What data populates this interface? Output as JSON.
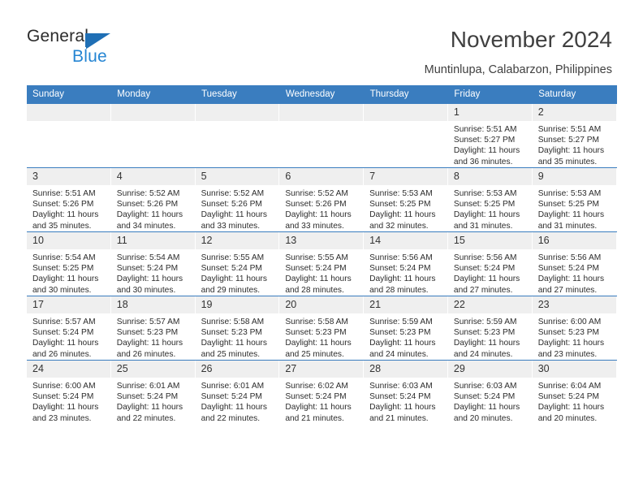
{
  "brand": {
    "name_part1": "General",
    "name_part2": "Blue",
    "triangle_color": "#1f6fb5",
    "blue_text_color": "#2585d3"
  },
  "header": {
    "title": "November 2024",
    "subtitle": "Muntinlupa, Calabarzon, Philippines",
    "accent_color": "#3a7dbf",
    "daynum_background": "#efefef"
  },
  "weekdays": [
    "Sunday",
    "Monday",
    "Tuesday",
    "Wednesday",
    "Thursday",
    "Friday",
    "Saturday"
  ],
  "labels": {
    "sunrise_prefix": "Sunrise:",
    "sunset_prefix": "Sunset:",
    "daylight_prefix": "Daylight:"
  },
  "weeks": [
    [
      {
        "day": "",
        "empty": true
      },
      {
        "day": "",
        "empty": true
      },
      {
        "day": "",
        "empty": true
      },
      {
        "day": "",
        "empty": true
      },
      {
        "day": "",
        "empty": true
      },
      {
        "day": "1",
        "sunrise": "Sunrise: 5:51 AM",
        "sunset": "Sunset: 5:27 PM",
        "daylight_line1": "Daylight: 11 hours",
        "daylight_line2": "and 36 minutes."
      },
      {
        "day": "2",
        "sunrise": "Sunrise: 5:51 AM",
        "sunset": "Sunset: 5:27 PM",
        "daylight_line1": "Daylight: 11 hours",
        "daylight_line2": "and 35 minutes."
      }
    ],
    [
      {
        "day": "3",
        "sunrise": "Sunrise: 5:51 AM",
        "sunset": "Sunset: 5:26 PM",
        "daylight_line1": "Daylight: 11 hours",
        "daylight_line2": "and 35 minutes."
      },
      {
        "day": "4",
        "sunrise": "Sunrise: 5:52 AM",
        "sunset": "Sunset: 5:26 PM",
        "daylight_line1": "Daylight: 11 hours",
        "daylight_line2": "and 34 minutes."
      },
      {
        "day": "5",
        "sunrise": "Sunrise: 5:52 AM",
        "sunset": "Sunset: 5:26 PM",
        "daylight_line1": "Daylight: 11 hours",
        "daylight_line2": "and 33 minutes."
      },
      {
        "day": "6",
        "sunrise": "Sunrise: 5:52 AM",
        "sunset": "Sunset: 5:26 PM",
        "daylight_line1": "Daylight: 11 hours",
        "daylight_line2": "and 33 minutes."
      },
      {
        "day": "7",
        "sunrise": "Sunrise: 5:53 AM",
        "sunset": "Sunset: 5:25 PM",
        "daylight_line1": "Daylight: 11 hours",
        "daylight_line2": "and 32 minutes."
      },
      {
        "day": "8",
        "sunrise": "Sunrise: 5:53 AM",
        "sunset": "Sunset: 5:25 PM",
        "daylight_line1": "Daylight: 11 hours",
        "daylight_line2": "and 31 minutes."
      },
      {
        "day": "9",
        "sunrise": "Sunrise: 5:53 AM",
        "sunset": "Sunset: 5:25 PM",
        "daylight_line1": "Daylight: 11 hours",
        "daylight_line2": "and 31 minutes."
      }
    ],
    [
      {
        "day": "10",
        "sunrise": "Sunrise: 5:54 AM",
        "sunset": "Sunset: 5:25 PM",
        "daylight_line1": "Daylight: 11 hours",
        "daylight_line2": "and 30 minutes."
      },
      {
        "day": "11",
        "sunrise": "Sunrise: 5:54 AM",
        "sunset": "Sunset: 5:24 PM",
        "daylight_line1": "Daylight: 11 hours",
        "daylight_line2": "and 30 minutes."
      },
      {
        "day": "12",
        "sunrise": "Sunrise: 5:55 AM",
        "sunset": "Sunset: 5:24 PM",
        "daylight_line1": "Daylight: 11 hours",
        "daylight_line2": "and 29 minutes."
      },
      {
        "day": "13",
        "sunrise": "Sunrise: 5:55 AM",
        "sunset": "Sunset: 5:24 PM",
        "daylight_line1": "Daylight: 11 hours",
        "daylight_line2": "and 28 minutes."
      },
      {
        "day": "14",
        "sunrise": "Sunrise: 5:56 AM",
        "sunset": "Sunset: 5:24 PM",
        "daylight_line1": "Daylight: 11 hours",
        "daylight_line2": "and 28 minutes."
      },
      {
        "day": "15",
        "sunrise": "Sunrise: 5:56 AM",
        "sunset": "Sunset: 5:24 PM",
        "daylight_line1": "Daylight: 11 hours",
        "daylight_line2": "and 27 minutes."
      },
      {
        "day": "16",
        "sunrise": "Sunrise: 5:56 AM",
        "sunset": "Sunset: 5:24 PM",
        "daylight_line1": "Daylight: 11 hours",
        "daylight_line2": "and 27 minutes."
      }
    ],
    [
      {
        "day": "17",
        "sunrise": "Sunrise: 5:57 AM",
        "sunset": "Sunset: 5:24 PM",
        "daylight_line1": "Daylight: 11 hours",
        "daylight_line2": "and 26 minutes."
      },
      {
        "day": "18",
        "sunrise": "Sunrise: 5:57 AM",
        "sunset": "Sunset: 5:23 PM",
        "daylight_line1": "Daylight: 11 hours",
        "daylight_line2": "and 26 minutes."
      },
      {
        "day": "19",
        "sunrise": "Sunrise: 5:58 AM",
        "sunset": "Sunset: 5:23 PM",
        "daylight_line1": "Daylight: 11 hours",
        "daylight_line2": "and 25 minutes."
      },
      {
        "day": "20",
        "sunrise": "Sunrise: 5:58 AM",
        "sunset": "Sunset: 5:23 PM",
        "daylight_line1": "Daylight: 11 hours",
        "daylight_line2": "and 25 minutes."
      },
      {
        "day": "21",
        "sunrise": "Sunrise: 5:59 AM",
        "sunset": "Sunset: 5:23 PM",
        "daylight_line1": "Daylight: 11 hours",
        "daylight_line2": "and 24 minutes."
      },
      {
        "day": "22",
        "sunrise": "Sunrise: 5:59 AM",
        "sunset": "Sunset: 5:23 PM",
        "daylight_line1": "Daylight: 11 hours",
        "daylight_line2": "and 24 minutes."
      },
      {
        "day": "23",
        "sunrise": "Sunrise: 6:00 AM",
        "sunset": "Sunset: 5:23 PM",
        "daylight_line1": "Daylight: 11 hours",
        "daylight_line2": "and 23 minutes."
      }
    ],
    [
      {
        "day": "24",
        "sunrise": "Sunrise: 6:00 AM",
        "sunset": "Sunset: 5:24 PM",
        "daylight_line1": "Daylight: 11 hours",
        "daylight_line2": "and 23 minutes."
      },
      {
        "day": "25",
        "sunrise": "Sunrise: 6:01 AM",
        "sunset": "Sunset: 5:24 PM",
        "daylight_line1": "Daylight: 11 hours",
        "daylight_line2": "and 22 minutes."
      },
      {
        "day": "26",
        "sunrise": "Sunrise: 6:01 AM",
        "sunset": "Sunset: 5:24 PM",
        "daylight_line1": "Daylight: 11 hours",
        "daylight_line2": "and 22 minutes."
      },
      {
        "day": "27",
        "sunrise": "Sunrise: 6:02 AM",
        "sunset": "Sunset: 5:24 PM",
        "daylight_line1": "Daylight: 11 hours",
        "daylight_line2": "and 21 minutes."
      },
      {
        "day": "28",
        "sunrise": "Sunrise: 6:03 AM",
        "sunset": "Sunset: 5:24 PM",
        "daylight_line1": "Daylight: 11 hours",
        "daylight_line2": "and 21 minutes."
      },
      {
        "day": "29",
        "sunrise": "Sunrise: 6:03 AM",
        "sunset": "Sunset: 5:24 PM",
        "daylight_line1": "Daylight: 11 hours",
        "daylight_line2": "and 20 minutes."
      },
      {
        "day": "30",
        "sunrise": "Sunrise: 6:04 AM",
        "sunset": "Sunset: 5:24 PM",
        "daylight_line1": "Daylight: 11 hours",
        "daylight_line2": "and 20 minutes."
      }
    ]
  ]
}
